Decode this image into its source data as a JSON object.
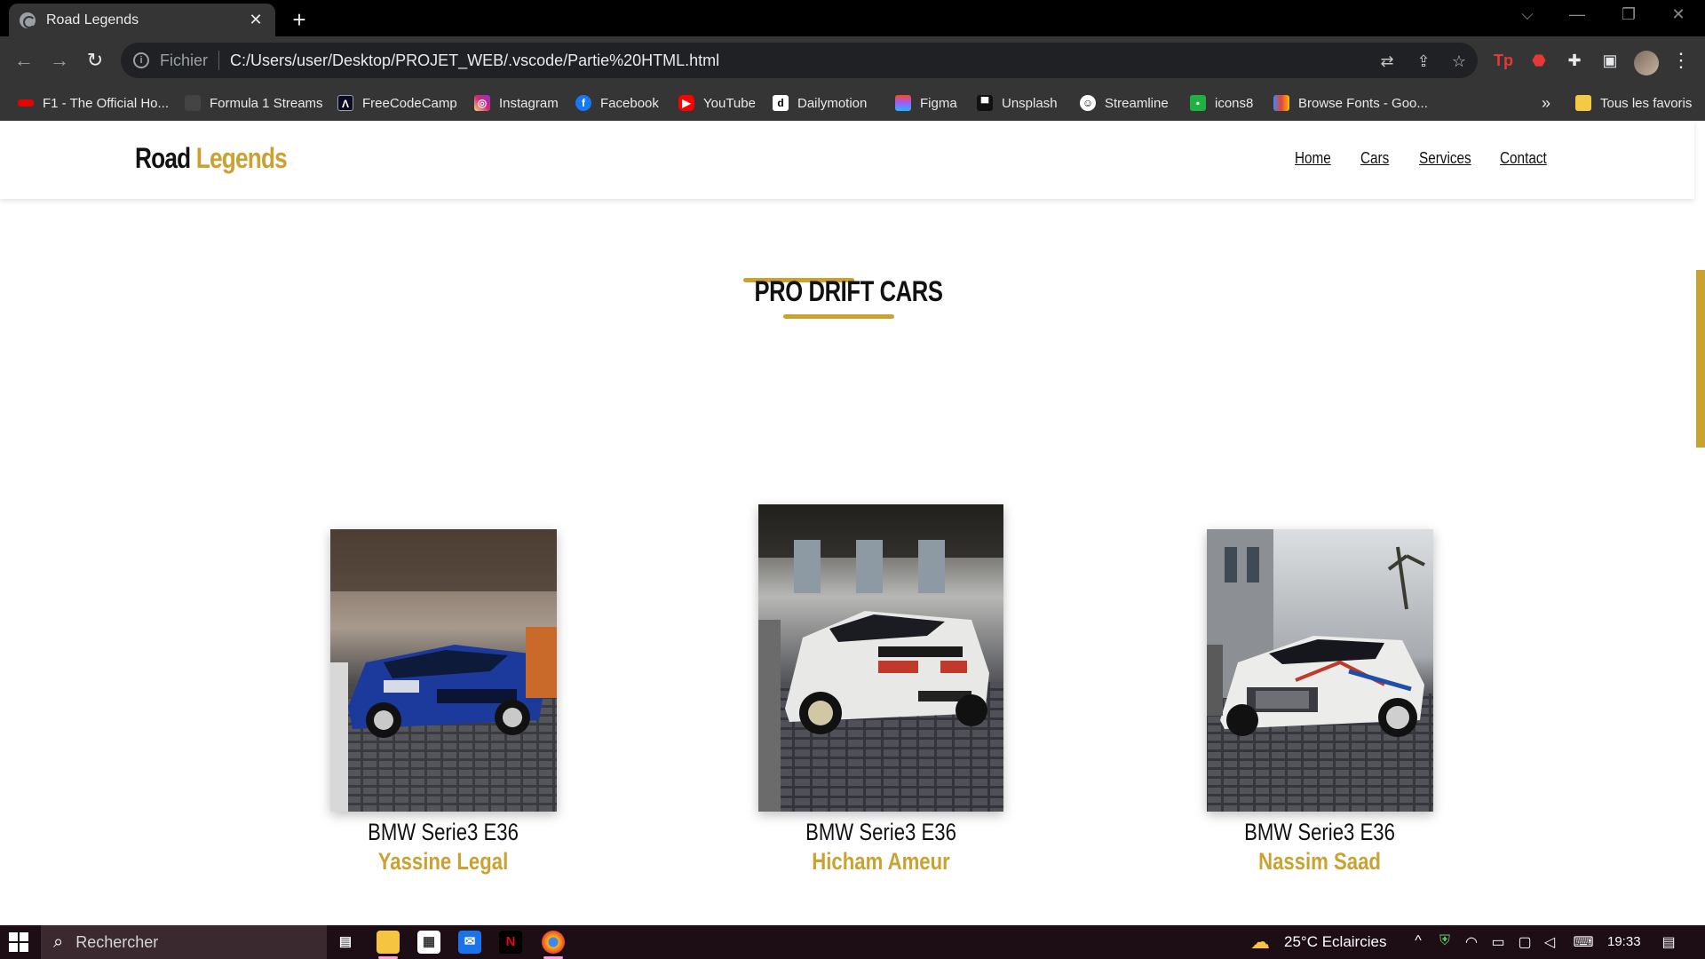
{
  "browser": {
    "tab_title": "Road Legends",
    "tab_close": "✕",
    "new_tab": "+",
    "scheme_label": "Fichier",
    "url": "C:/Users/user/Desktop/PROJET_WEB/.vscode/Partie%20HTML.html",
    "bookmarks": [
      {
        "label": "F1 - The Official Ho...",
        "icon": "f1-icon",
        "color": "#e10600"
      },
      {
        "label": "Formula 1 Streams",
        "icon": "formula1-streams-icon",
        "color": "#444444"
      },
      {
        "label": "FreeCodeCamp",
        "icon": "freecodecamp-icon",
        "color": "#0a0a23"
      },
      {
        "label": "Instagram",
        "icon": "instagram-icon",
        "color": "#d6249f"
      },
      {
        "label": "Facebook",
        "icon": "facebook-icon",
        "color": "#1877f2"
      },
      {
        "label": "YouTube",
        "icon": "youtube-icon",
        "color": "#ff0000"
      },
      {
        "label": "Dailymotion",
        "icon": "dailymotion-icon",
        "color": "#ffffff"
      },
      {
        "label": "Figma",
        "icon": "figma-icon",
        "color": "#a259ff"
      },
      {
        "label": "Unsplash",
        "icon": "unsplash-icon",
        "color": "#111111"
      },
      {
        "label": "Streamline",
        "icon": "streamline-icon",
        "color": "#111111"
      },
      {
        "label": "icons8",
        "icon": "icons8-icon",
        "color": "#1fb141"
      },
      {
        "label": "Browse Fonts - Goo...",
        "icon": "google-fonts-icon",
        "color": "#4285f4"
      }
    ],
    "more_bookmarks": "»",
    "all_bookmarks": "Tous les favoris"
  },
  "site": {
    "logo_first": "Road",
    "logo_second": "Legends",
    "nav": [
      "Home",
      "Cars",
      "Services",
      "Contact"
    ],
    "accent": "#c9a232",
    "section_title": "PRO DRIFT CARS",
    "cars": [
      {
        "model": "BMW Serie3 E36",
        "driver": "Yassine Legal",
        "livery": "blue"
      },
      {
        "model": "BMW Serie3 E36",
        "driver": "Hicham Ameur",
        "livery": "white"
      },
      {
        "model": "BMW Serie3 E36",
        "driver": "Nassim Saad",
        "livery": "white-graphics"
      }
    ]
  },
  "taskbar": {
    "search_placeholder": "Rechercher",
    "weather": "25°C  Eclaircies",
    "time": "19:33"
  }
}
